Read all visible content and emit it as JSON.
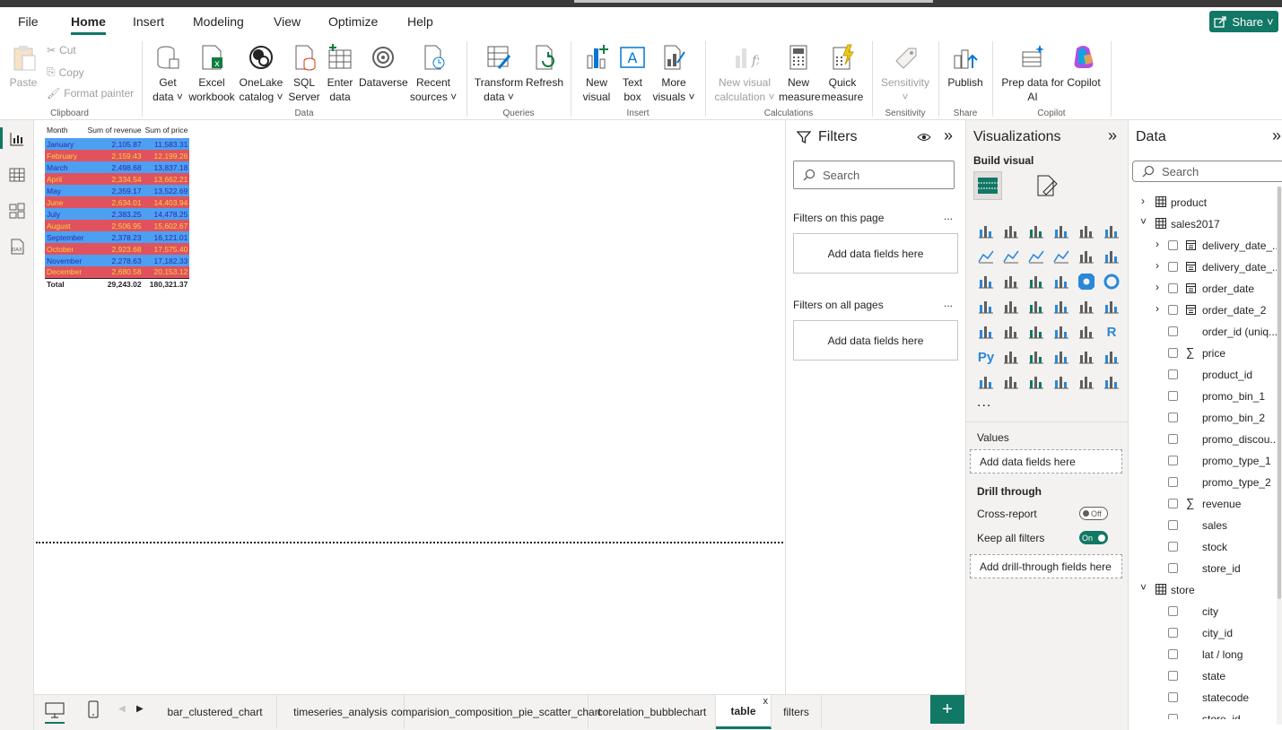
{
  "menu": [
    "File",
    "Home",
    "Insert",
    "Modeling",
    "View",
    "Optimize",
    "Help"
  ],
  "share_label": "Share",
  "ribbon": {
    "clipboard": {
      "paste": "Paste",
      "cut": "Cut",
      "copy": "Copy",
      "format_painter": "Format painter",
      "group": "Clipboard"
    },
    "data": {
      "buttons": [
        {
          "l1": "Get",
          "l2": "data ˅"
        },
        {
          "l1": "Excel",
          "l2": "workbook"
        },
        {
          "l1": "OneLake",
          "l2": "catalog ˅"
        },
        {
          "l1": "SQL",
          "l2": "Server"
        },
        {
          "l1": "Enter",
          "l2": "data"
        },
        {
          "l1": "Dataverse",
          "l2": ""
        },
        {
          "l1": "Recent",
          "l2": "sources ˅"
        }
      ],
      "group": "Data"
    },
    "queries": {
      "buttons": [
        {
          "l1": "Transform",
          "l2": "data ˅"
        },
        {
          "l1": "Refresh",
          "l2": ""
        }
      ],
      "group": "Queries"
    },
    "insert": {
      "buttons": [
        {
          "l1": "New",
          "l2": "visual"
        },
        {
          "l1": "Text",
          "l2": "box"
        },
        {
          "l1": "More",
          "l2": "visuals ˅"
        }
      ],
      "group": "Insert"
    },
    "calculations": {
      "buttons": [
        {
          "l1": "New visual",
          "l2": "calculation ˅"
        },
        {
          "l1": "New",
          "l2": "measure"
        },
        {
          "l1": "Quick",
          "l2": "measure"
        }
      ],
      "group": "Calculations"
    },
    "sensitivity": {
      "l1": "Sensitivity",
      "l2": "˅",
      "group": "Sensitivity"
    },
    "share": {
      "l1": "Publish",
      "group": "Share"
    },
    "copilot": {
      "l1": "Prep data for",
      "l2": "AI",
      "l3": "Copilot",
      "group": "Copilot"
    }
  },
  "table": {
    "headers": [
      "Month",
      "Sum of revenue",
      "Sum of price"
    ],
    "rows": [
      [
        "January",
        "2,105.87",
        "11,583.31"
      ],
      [
        "February",
        "2,159.43",
        "12,199.26"
      ],
      [
        "March",
        "2,498.68",
        "13,837.18"
      ],
      [
        "April",
        "2,334.54",
        "13,662.21"
      ],
      [
        "May",
        "2,359.17",
        "13,522.69"
      ],
      [
        "June",
        "2,634.01",
        "14,403.94"
      ],
      [
        "July",
        "2,383.25",
        "14,478.25"
      ],
      [
        "August",
        "2,506.95",
        "15,602.67"
      ],
      [
        "September",
        "2,378.23",
        "16,121.01"
      ],
      [
        "October",
        "2,923.68",
        "17,575.40"
      ],
      [
        "November",
        "2,278.63",
        "17,182.33"
      ],
      [
        "December",
        "2,680.58",
        "20,153.12"
      ]
    ],
    "total": [
      "Total",
      "29,243.02",
      "180,321.37"
    ],
    "colors": {
      "blue_bg": "#4d9ff2",
      "red_bg": "#e0525e"
    }
  },
  "filters": {
    "title": "Filters",
    "search_placeholder": "Search",
    "on_page": "Filters on this page",
    "all_pages": "Filters on all pages",
    "add_fields": "Add data fields here",
    "more": "..."
  },
  "visualizations": {
    "title": "Visualizations",
    "build_visual": "Build visual",
    "more": "...",
    "values": "Values",
    "add_fields": "Add data fields here",
    "drill_through": "Drill through",
    "cross_report": "Cross-report",
    "cross_report_state": "Off",
    "keep_filters": "Keep all filters",
    "keep_filters_state": "On",
    "add_drill": "Add drill-through fields here"
  },
  "data_pane": {
    "title": "Data",
    "search_placeholder": "Search",
    "tables": [
      {
        "name": "product",
        "expanded": false
      },
      {
        "name": "sales2017",
        "expanded": true
      }
    ],
    "sales_fields": [
      {
        "name": "delivery_date_...",
        "type": "date"
      },
      {
        "name": "delivery_date_...",
        "type": "date"
      },
      {
        "name": "order_date",
        "type": "date"
      },
      {
        "name": "order_date_2",
        "type": "date"
      },
      {
        "name": "order_id (uniq...",
        "type": "field"
      },
      {
        "name": "price",
        "type": "sum"
      },
      {
        "name": "product_id",
        "type": "field"
      },
      {
        "name": "promo_bin_1",
        "type": "field"
      },
      {
        "name": "promo_bin_2",
        "type": "field"
      },
      {
        "name": "promo_discou...",
        "type": "field"
      },
      {
        "name": "promo_type_1",
        "type": "field"
      },
      {
        "name": "promo_type_2",
        "type": "field"
      },
      {
        "name": "revenue",
        "type": "sum"
      },
      {
        "name": "sales",
        "type": "field"
      },
      {
        "name": "stock",
        "type": "field"
      },
      {
        "name": "store_id",
        "type": "field"
      }
    ],
    "store_table": "store",
    "store_fields": [
      "city",
      "city_id",
      "lat / long",
      "state",
      "statecode",
      "store_id"
    ]
  },
  "tabs": [
    "bar_clustered_chart",
    "timeseries_analysis",
    "comparision_composition_pie_scatter_chart",
    "corelation_bubblechart",
    "table",
    "filters"
  ],
  "active_tab": "table",
  "add_tab": "+",
  "close_tab": "x"
}
